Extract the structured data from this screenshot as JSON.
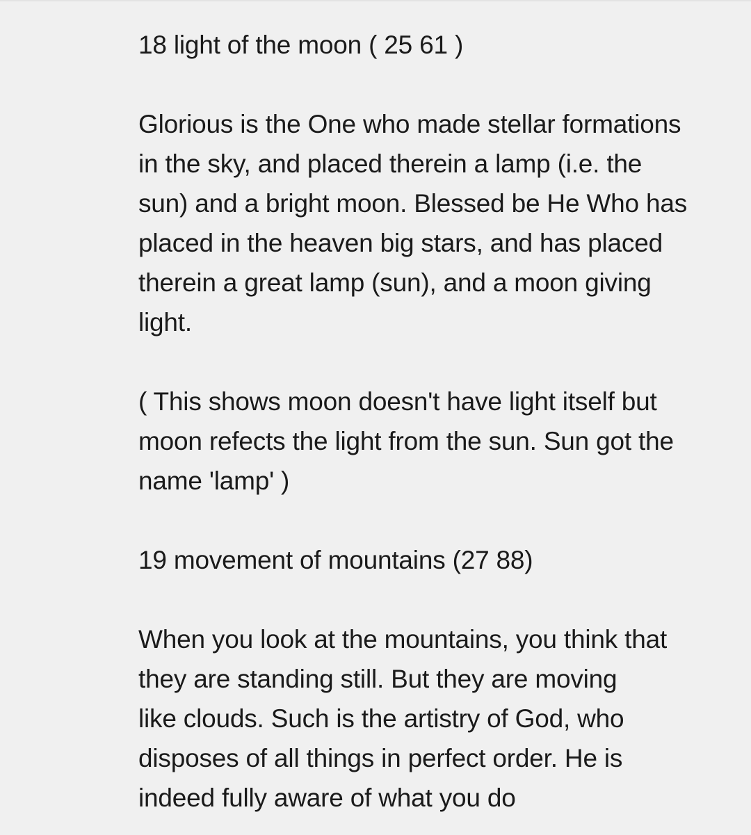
{
  "note": {
    "heading_18": "18 light of the moon ( 25 61 )",
    "verse_18": "Glorious is the One who made stellar formations\nin the sky, and placed therein a lamp (i.e. the\nsun) and a bright moon. Blessed be He Who has\nplaced in the heaven big stars, and has placed\ntherein a great lamp (sun), and a moon giving\nlight.",
    "comment_18": "( This shows moon doesn't have light itself but\nmoon refects the light from the sun. Sun got the\nname 'lamp' )",
    "heading_19": "19 movement of mountains (27 88)",
    "verse_19": "When you look at the mountains, you think that\nthey are standing still. But they are moving\nlike clouds. Such is the artistry of God, who\ndisposes of all things in perfect order. He is\nindeed fully aware of what you do"
  },
  "colors": {
    "background": "#f0f0f0",
    "text": "#1a1a1a"
  }
}
